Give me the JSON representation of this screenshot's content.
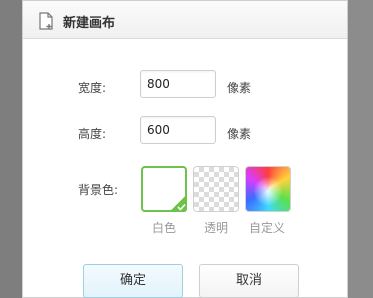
{
  "dialog": {
    "title": "新建画布",
    "icon": "new-document-icon"
  },
  "form": {
    "width_label": "宽度:",
    "width_value": "800",
    "width_unit": "像素",
    "height_label": "高度:",
    "height_value": "600",
    "height_unit": "像素",
    "background_label": "背景色:"
  },
  "background_options": [
    {
      "label": "白色",
      "selected": true
    },
    {
      "label": "透明",
      "selected": false
    },
    {
      "label": "自定义",
      "selected": false
    }
  ],
  "buttons": {
    "ok": "确定",
    "cancel": "取消"
  },
  "colors": {
    "selected_border": "#6cc24a",
    "ok_border": "#9fcfe3"
  }
}
